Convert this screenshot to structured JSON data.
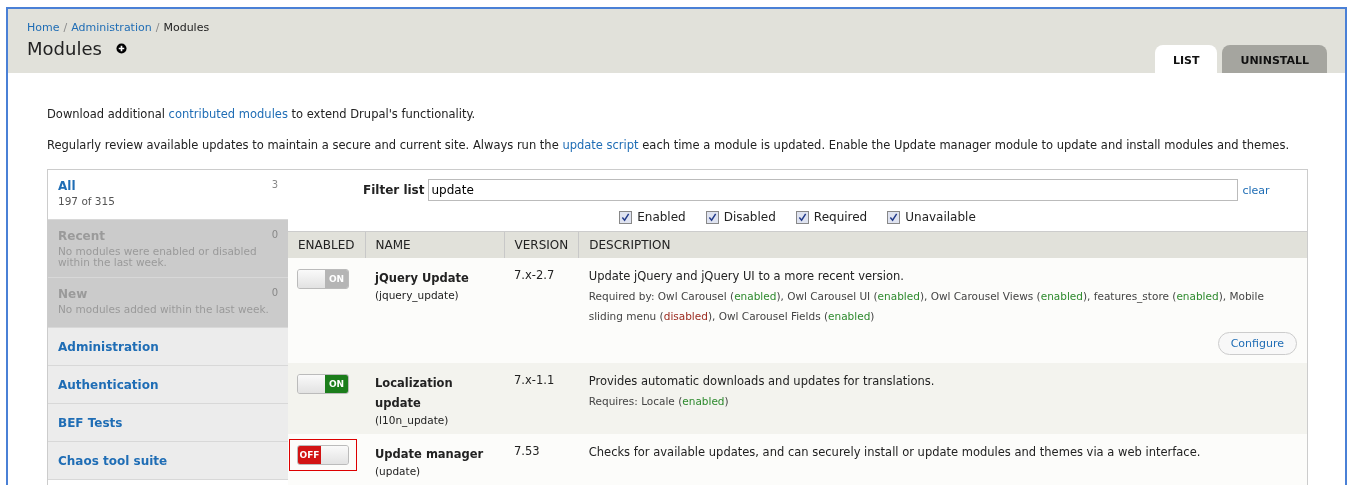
{
  "breadcrumb": [
    {
      "label": "Home",
      "kind": "link"
    },
    {
      "label": "/",
      "kind": "separator"
    },
    {
      "label": "Administration",
      "kind": "link"
    },
    {
      "label": "/",
      "kind": "separator"
    },
    {
      "label": "Modules",
      "kind": "current"
    }
  ],
  "title": "Modules",
  "tabs": [
    {
      "label": "LIST",
      "selected": true
    },
    {
      "label": "UNINSTALL",
      "selected": false
    }
  ],
  "intro": [
    [
      {
        "text": "Download additional ",
        "kind": "plain"
      },
      {
        "text": "contributed modules",
        "kind": "link"
      },
      {
        "text": " to extend Drupal's functionality.",
        "kind": "plain"
      }
    ],
    [
      {
        "text": "Regularly review available updates to maintain a secure and current site. Always run the ",
        "kind": "plain"
      },
      {
        "text": "update script",
        "kind": "link"
      },
      {
        "text": " each time a module is updated. Enable the Update manager module to update and install modules and themes.",
        "kind": "plain"
      }
    ]
  ],
  "sidebar": {
    "items": [
      {
        "label": "All",
        "count": "3",
        "note": "197 of 315",
        "selected": true,
        "disabled": false
      },
      {
        "label": "Recent",
        "count": "0",
        "note": "No modules were enabled or disabled within the last week.",
        "selected": false,
        "disabled": true
      },
      {
        "label": "New",
        "count": "0",
        "note": "No modules added within the last week.",
        "selected": false,
        "disabled": true
      },
      {
        "label": "Administration",
        "selected": false,
        "disabled": false
      },
      {
        "label": "Authentication",
        "selected": false,
        "disabled": false
      },
      {
        "label": "BEF Tests",
        "selected": false,
        "disabled": false
      },
      {
        "label": "Chaos tool suite",
        "selected": false,
        "disabled": false
      }
    ]
  },
  "filter": {
    "label": "Filter list",
    "value": "update",
    "clear": "clear"
  },
  "filter_checkboxes": [
    {
      "label": "Enabled",
      "checked": true
    },
    {
      "label": "Disabled",
      "checked": true
    },
    {
      "label": "Required",
      "checked": true
    },
    {
      "label": "Unavailable",
      "checked": true
    }
  ],
  "table": {
    "columns": [
      "ENABLED",
      "NAME",
      "VERSION",
      "DESCRIPTION"
    ],
    "rows": [
      {
        "toggle": {
          "label": "ON",
          "on": true,
          "disabled": true
        },
        "highlighted": false,
        "name": "jQuery Update",
        "machine": "(jquery_update)",
        "version": "7.x-2.7",
        "description": "Update jQuery and jQuery UI to a more recent version.",
        "requirements": [
          {
            "text": "Required by: Owl Carousel (",
            "kind": "plain"
          },
          {
            "text": "enabled",
            "kind": "enabled"
          },
          {
            "text": "), Owl Carousel UI (",
            "kind": "plain"
          },
          {
            "text": "enabled",
            "kind": "enabled"
          },
          {
            "text": "), Owl Carousel Views (",
            "kind": "plain"
          },
          {
            "text": "enabled",
            "kind": "enabled"
          },
          {
            "text": "), features_store (",
            "kind": "plain"
          },
          {
            "text": "enabled",
            "kind": "enabled"
          },
          {
            "text": "), Mobile sliding menu (",
            "kind": "plain"
          },
          {
            "text": "disabled",
            "kind": "disabled"
          },
          {
            "text": "), Owl Carousel Fields (",
            "kind": "plain"
          },
          {
            "text": "enabled",
            "kind": "enabled"
          },
          {
            "text": ")",
            "kind": "plain"
          }
        ],
        "action": "Configure"
      },
      {
        "toggle": {
          "label": "ON",
          "on": true,
          "disabled": false
        },
        "highlighted": false,
        "name": "Localization update",
        "machine": "(l10n_update)",
        "version": "7.x-1.1",
        "description": "Provides automatic downloads and updates for translations.",
        "requirements": [
          {
            "text": "Requires: Locale (",
            "kind": "plain"
          },
          {
            "text": "enabled",
            "kind": "enabled"
          },
          {
            "text": ")",
            "kind": "plain"
          }
        ]
      },
      {
        "toggle": {
          "label": "OFF",
          "on": false,
          "disabled": false
        },
        "highlighted": true,
        "name": "Update manager",
        "machine": "(update)",
        "version": "7.53",
        "description": "Checks for available updates, and can securely install or update modules and themes via a web interface."
      }
    ]
  }
}
